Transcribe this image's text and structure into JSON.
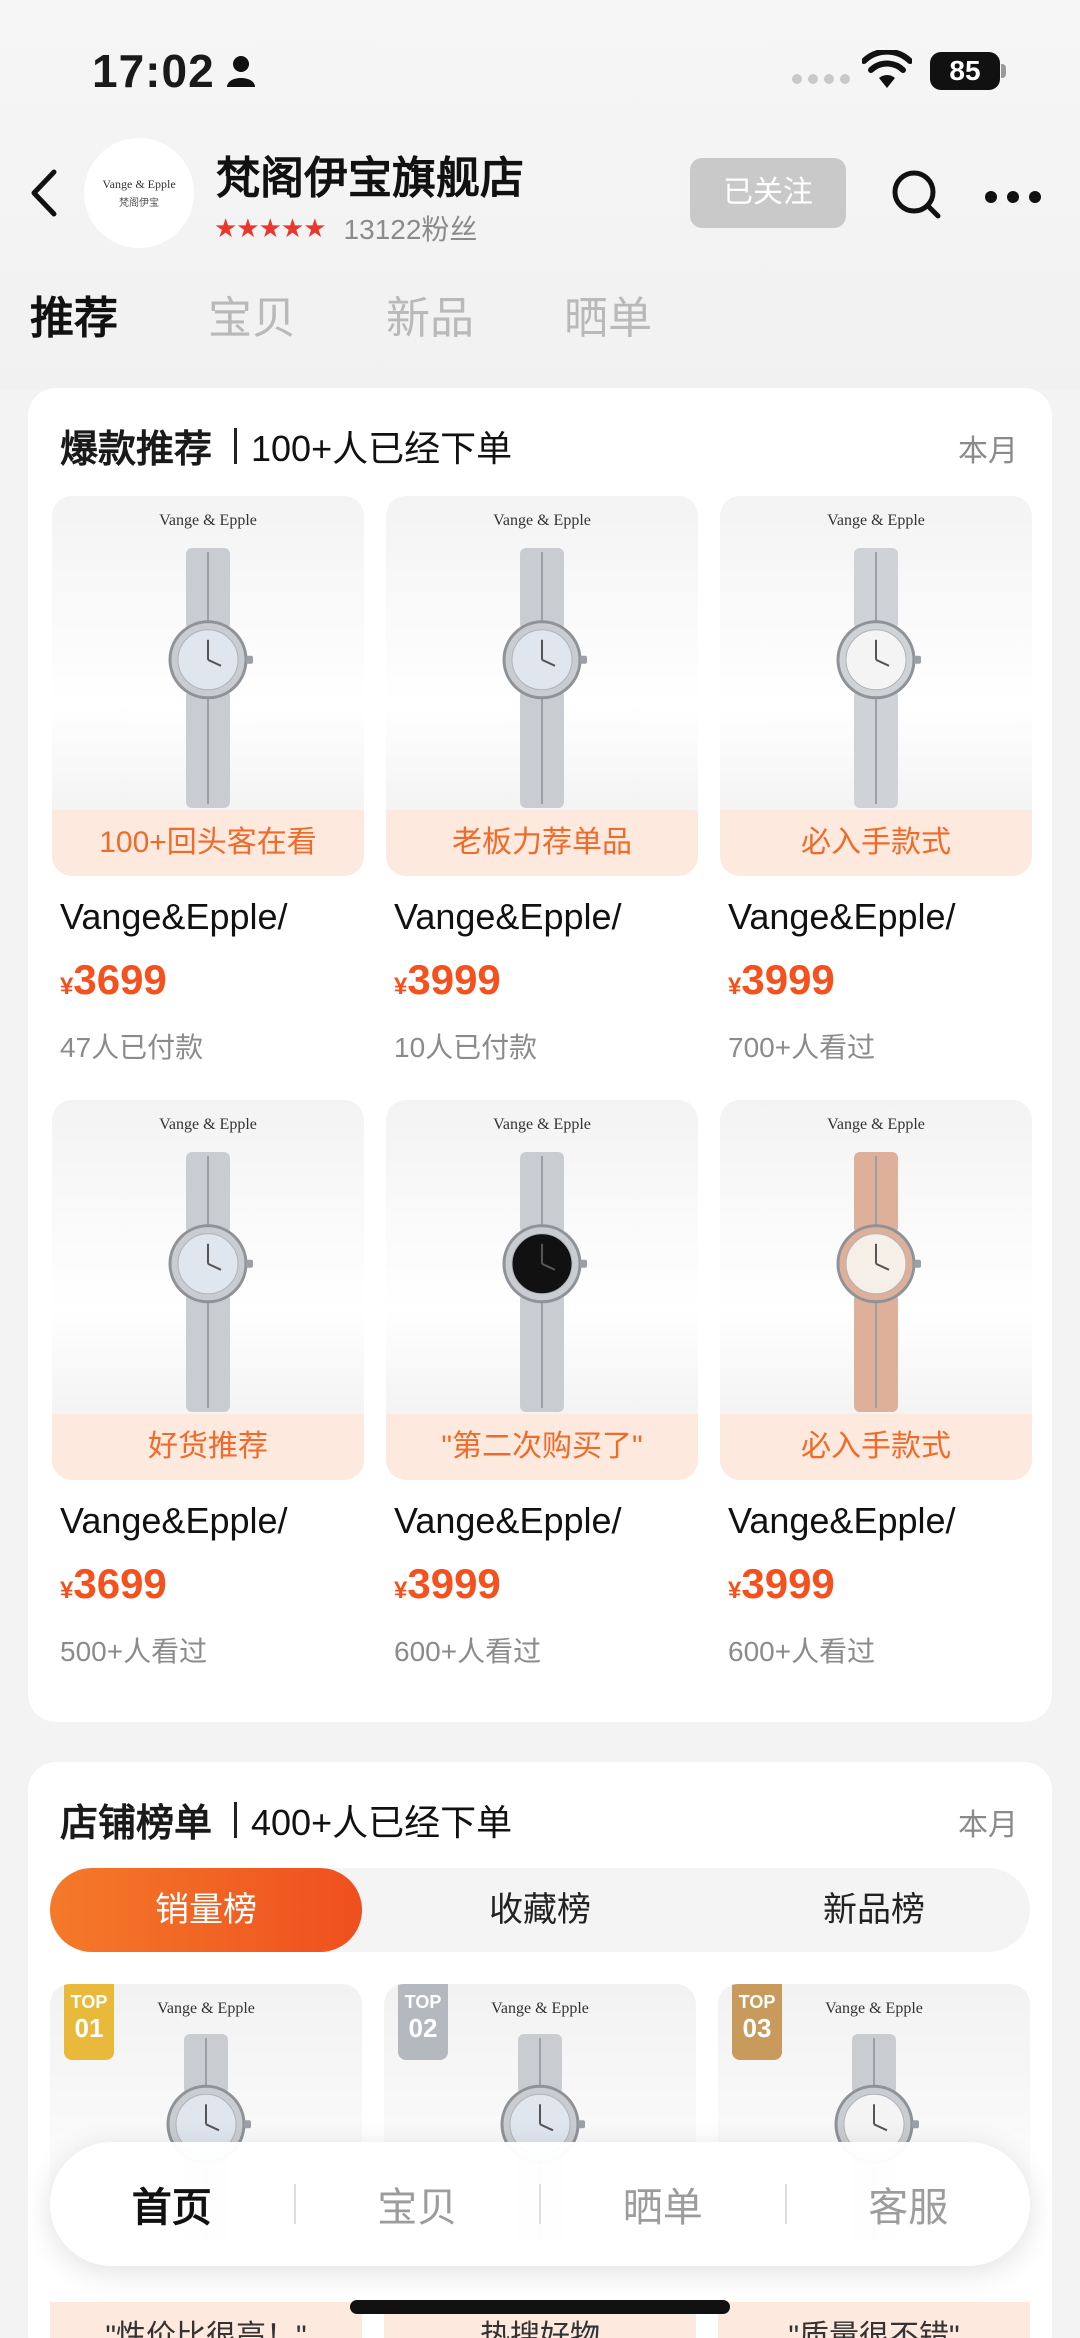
{
  "status_bar": {
    "time": "17:02",
    "battery": "85"
  },
  "store": {
    "logo_text_en": "Vange & Epple",
    "logo_text_cn": "梵阁伊宝",
    "name": "梵阁伊宝旗舰店",
    "stars": "★★★★★",
    "fans": "13122粉丝",
    "follow_label": "已关注"
  },
  "tabs": [
    "推荐",
    "宝贝",
    "新品",
    "晒单"
  ],
  "hot": {
    "title": "爆款推荐",
    "subtitle": "100+人已经下单",
    "period": "本月",
    "items": [
      {
        "brand": "Vange & Epple",
        "tag": "100+回头客在看",
        "name": "Vange&Epple/",
        "yen": "¥",
        "price": "3699",
        "stat": "47人已付款",
        "dial": "#dfe6ee",
        "band": "#c9ccd0"
      },
      {
        "brand": "Vange & Epple",
        "tag": "老板力荐单品",
        "name": "Vange&Epple/",
        "yen": "¥",
        "price": "3999",
        "stat": "10人已付款",
        "dial": "#dfe6ee",
        "band": "#c9ccd0"
      },
      {
        "brand": "Vange & Epple",
        "tag": "必入手款式",
        "name": "Vange&Epple/",
        "yen": "¥",
        "price": "3999",
        "stat": "700+人看过",
        "dial": "#f4f4f4",
        "band": "#cfd2d6"
      },
      {
        "brand": "Vange & Epple",
        "tag": "好货推荐",
        "name": "Vange&Epple/",
        "yen": "¥",
        "price": "3699",
        "stat": "500+人看过",
        "dial": "#dfe6ee",
        "band": "#c9ccd0"
      },
      {
        "brand": "Vange & Epple",
        "tag": "\"第二次购买了\"",
        "name": "Vange&Epple/",
        "yen": "¥",
        "price": "3999",
        "stat": "600+人看过",
        "dial": "#111111",
        "band": "#c9ccd0"
      },
      {
        "brand": "Vange & Epple",
        "tag": "必入手款式",
        "name": "Vange&Epple/",
        "yen": "¥",
        "price": "3999",
        "stat": "600+人看过",
        "dial": "#f6efe8",
        "band": "#deb09a"
      }
    ]
  },
  "rank": {
    "title": "店铺榜单",
    "subtitle": "400+人已经下单",
    "period": "本月",
    "tabs": [
      "销量榜",
      "收藏榜",
      "新品榜"
    ],
    "items": [
      {
        "brand": "Vange & Epple",
        "badge_top": "TOP",
        "badge_num": "01",
        "badge_color": "#e9b93b",
        "tag": "\"性价比很高！\"",
        "dial": "#dfe6ee"
      },
      {
        "brand": "Vange & Epple",
        "badge_top": "TOP",
        "badge_num": "02",
        "badge_color": "#b4b8bf",
        "tag": "热搜好物",
        "dial": "#dfe6ee"
      },
      {
        "brand": "Vange & Epple",
        "badge_top": "TOP",
        "badge_num": "03",
        "badge_color": "#c89a5c",
        "tag": "\"质量很不错\"",
        "dial": "#f4f4f4"
      }
    ]
  },
  "bottom_nav": [
    "首页",
    "宝贝",
    "晒单",
    "客服"
  ],
  "colors": {
    "accent": "#f4511e",
    "tag_bg": "#fde9dd",
    "tag_text": "#f06a2a"
  }
}
